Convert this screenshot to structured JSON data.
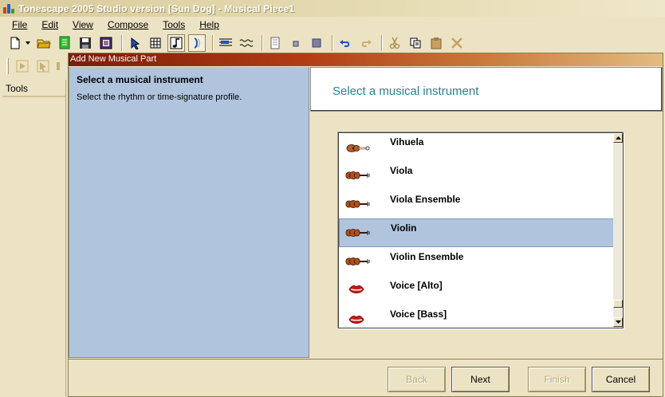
{
  "window": {
    "title": "Tonescape 2005 Studio  version [Sun Dog]  -  Musical Piece1"
  },
  "menu": [
    {
      "label": "File",
      "key": "F"
    },
    {
      "label": "Edit",
      "key": "E"
    },
    {
      "label": "View",
      "key": "V"
    },
    {
      "label": "Compose",
      "key": "C"
    },
    {
      "label": "Tools",
      "key": "T"
    },
    {
      "label": "Help",
      "key": "H"
    }
  ],
  "tools_panel": {
    "header": "Tools"
  },
  "dialog": {
    "title": "Add New Musical Part",
    "left": {
      "heading": "Select a musical instrument",
      "description": "Select the rhythm or time-signature profile."
    },
    "right_heading": "Select a musical instrument",
    "instruments": [
      {
        "label": "Vihuela",
        "icon": "guitar-icon",
        "selected": false
      },
      {
        "label": "Viola",
        "icon": "violin-icon",
        "selected": false
      },
      {
        "label": "Viola Ensemble",
        "icon": "violin-icon",
        "selected": false
      },
      {
        "label": "Violin",
        "icon": "violin-icon",
        "selected": true
      },
      {
        "label": "Violin Ensemble",
        "icon": "violin-icon",
        "selected": false
      },
      {
        "label": "Voice [Alto]",
        "icon": "lips-icon",
        "selected": false
      },
      {
        "label": "Voice [Bass]",
        "icon": "lips-icon",
        "selected": false
      }
    ],
    "buttons": {
      "back": "Back",
      "next": "Next",
      "finish": "Finish",
      "cancel": "Cancel"
    }
  },
  "colors": {
    "chrome": "#ece3c4",
    "dialog_title": "#7a1d08",
    "left_pane": "#b0c4de",
    "selection": "#b0c4de",
    "heading_teal": "#2e7e8f"
  }
}
